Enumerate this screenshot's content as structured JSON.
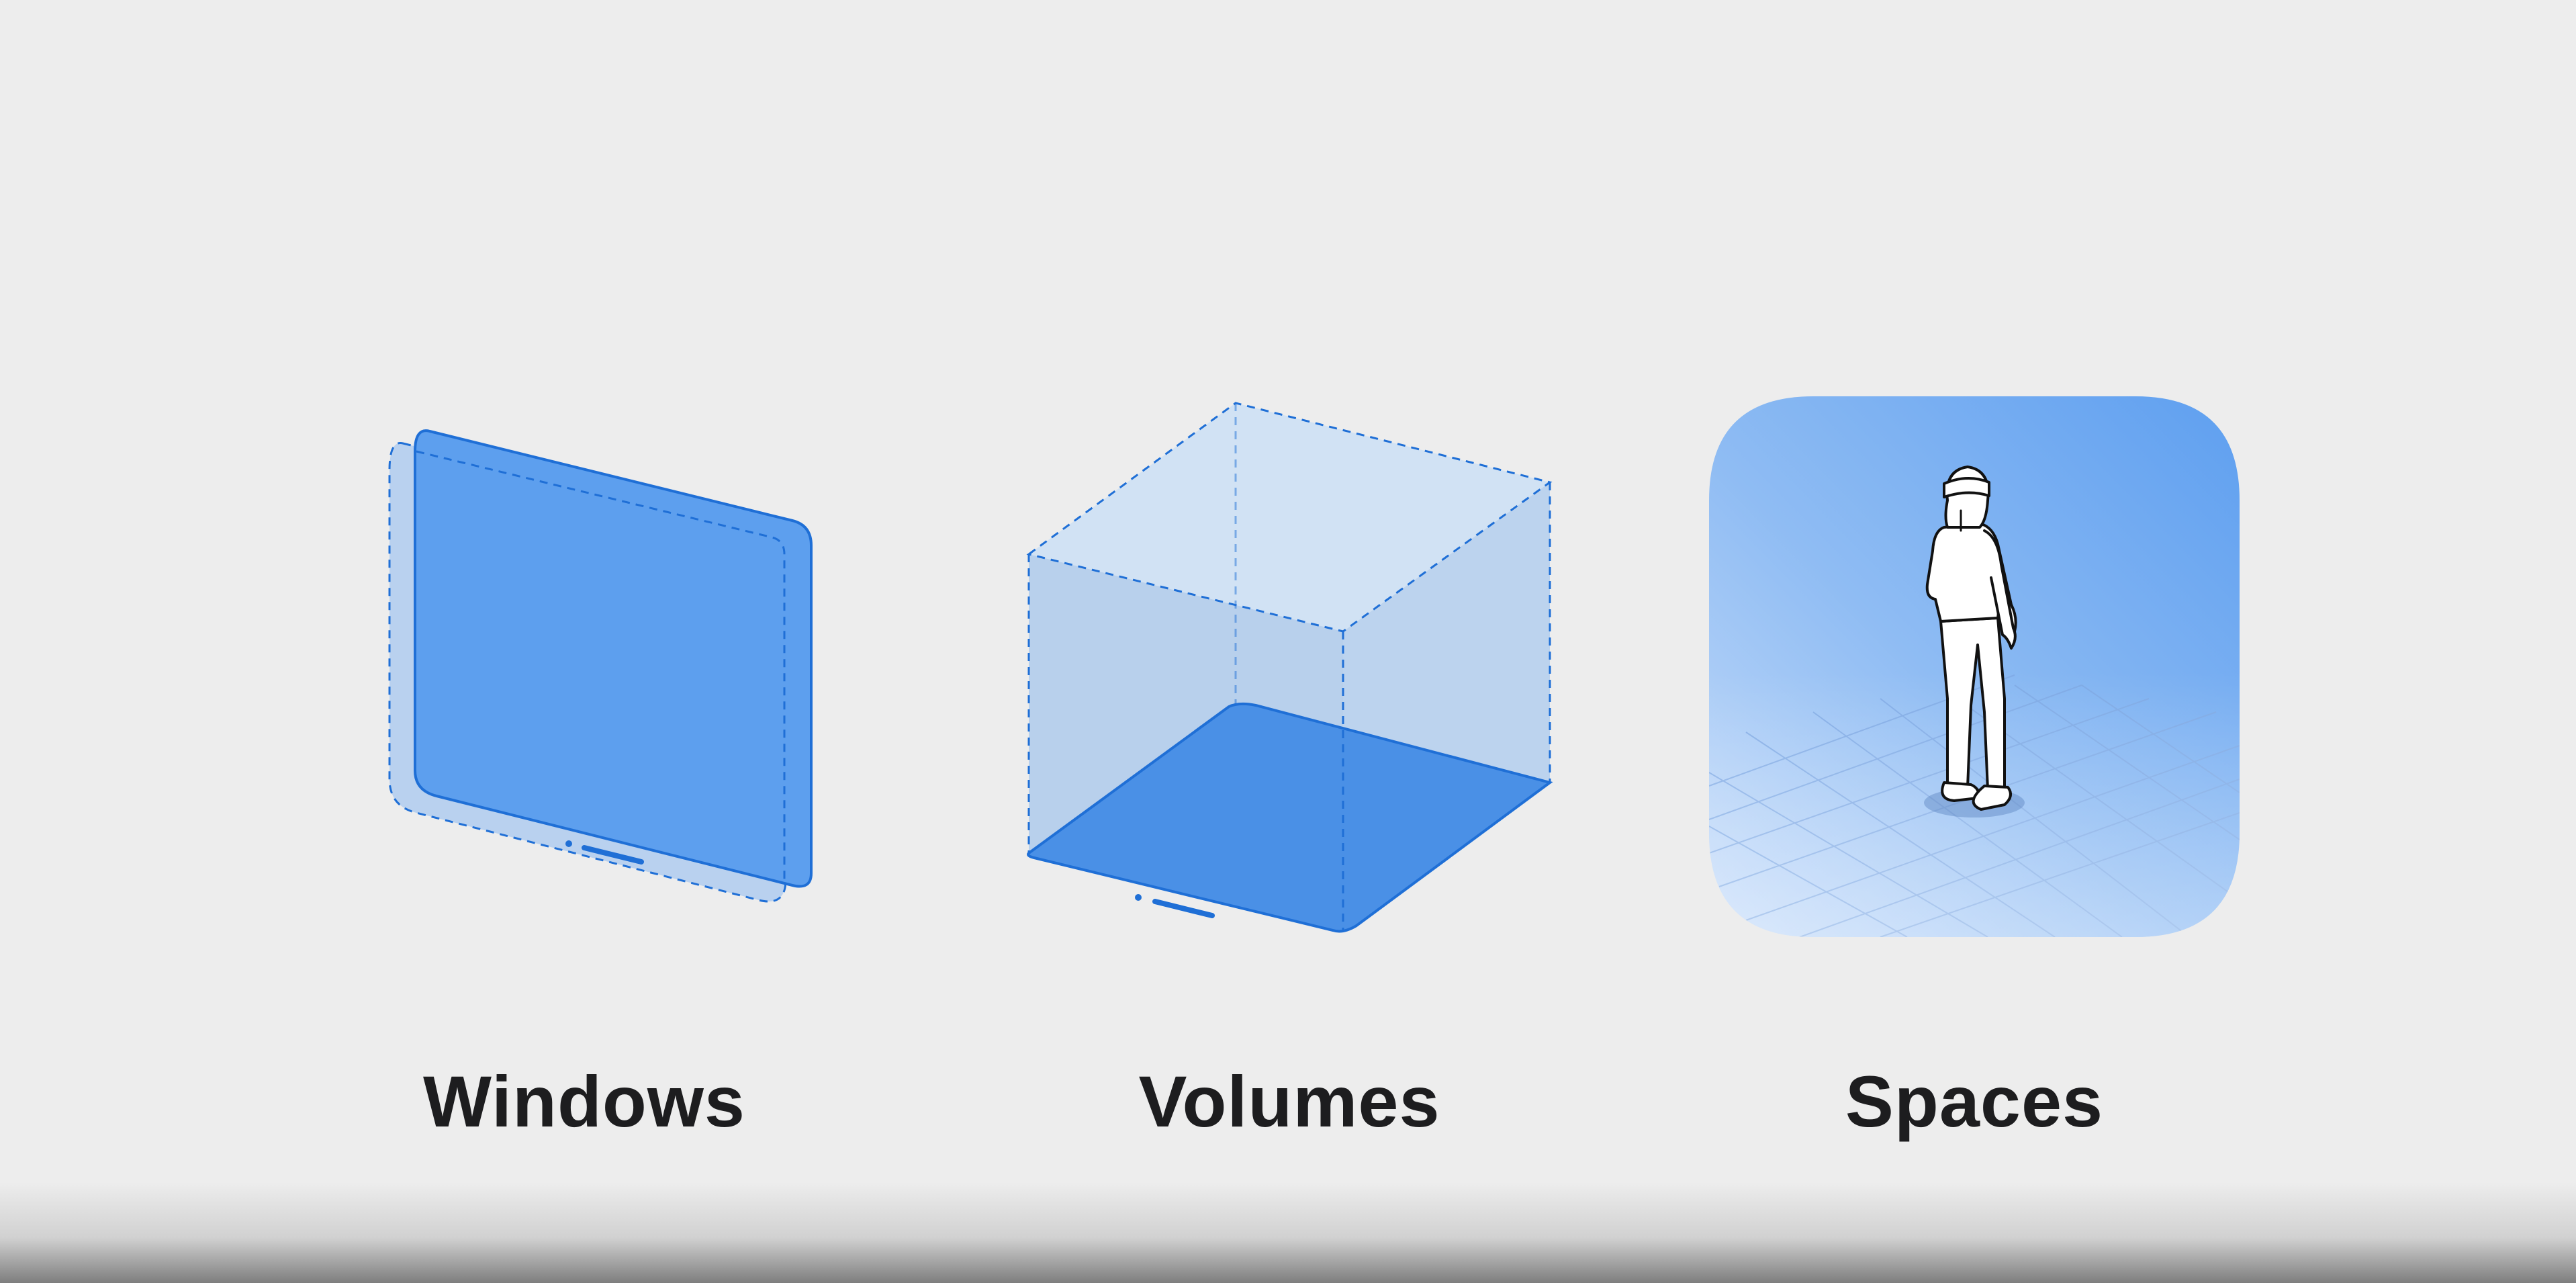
{
  "labels": {
    "windows": "Windows",
    "volumes": "Volumes",
    "spaces": "Spaces"
  },
  "colors": {
    "background": "#ededed",
    "accent_blue": "#1f6fd6",
    "panel_blue": "#5d9fee",
    "floor_blue": "#4a90e6",
    "light_blue": "#cfe0f3",
    "label_text": "#1d1d1f"
  },
  "icons": [
    "window-panel-icon",
    "volume-box-icon",
    "space-person-icon"
  ]
}
